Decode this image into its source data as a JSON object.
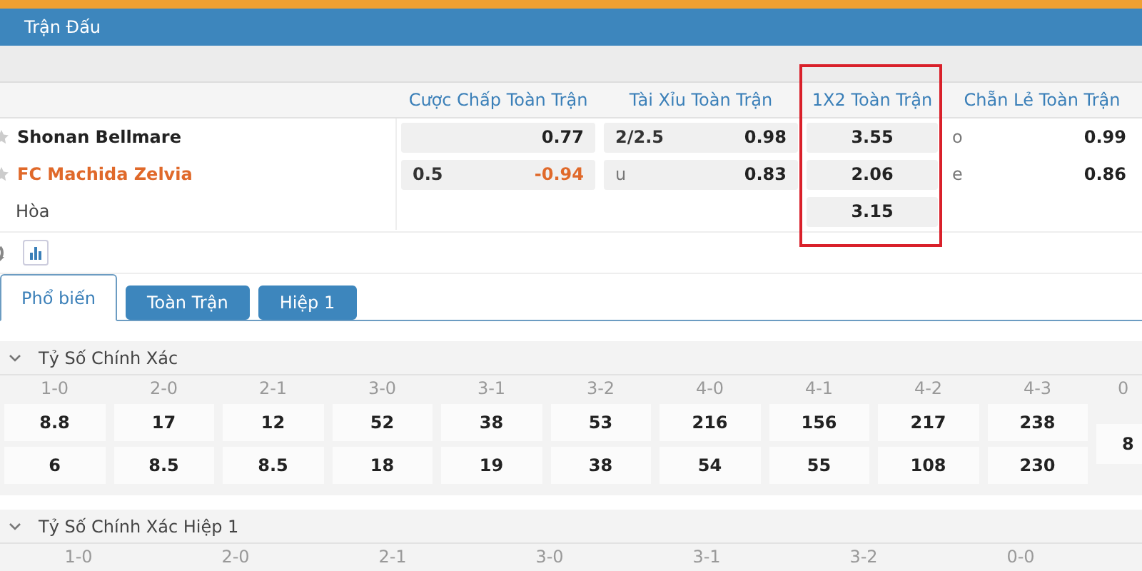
{
  "title": "Trận Đấu",
  "columns": [
    "Cược Chấp Toàn Trận",
    "Tài Xỉu Toàn Trận",
    "1X2 Toàn Trận",
    "Chẵn Lẻ Toàn Trận"
  ],
  "rows": [
    {
      "name": "Shonan Bellmare",
      "kind": "team",
      "highlighted": false,
      "handicap": {
        "odds": "0.77",
        "negative": false
      },
      "total": {
        "line": "2/2.5",
        "odds": "0.98"
      },
      "x12": "3.55",
      "oddeven": {
        "line": "o",
        "odds": "0.99"
      }
    },
    {
      "name": "FC Machida Zelvia",
      "kind": "team",
      "highlighted": true,
      "handicap": {
        "line": "0.5",
        "odds": "-0.94",
        "negative": true
      },
      "total": {
        "line": "u",
        "odds": "0.83"
      },
      "x12": "2.06",
      "oddeven": {
        "line": "e",
        "odds": "0.86"
      }
    },
    {
      "name": "Hòa",
      "kind": "draw",
      "x12": "3.15"
    }
  ],
  "tabs": [
    {
      "label": "Phổ biến",
      "selected": true
    },
    {
      "label": "Toàn Trận",
      "selected": false
    },
    {
      "label": "Hiệp 1",
      "selected": false
    }
  ],
  "sections": [
    {
      "title": "Tỷ Số Chính Xác",
      "expanded": true,
      "scores": [
        {
          "label": "1-0",
          "values": [
            "8.8",
            "6"
          ]
        },
        {
          "label": "2-0",
          "values": [
            "17",
            "8.5"
          ]
        },
        {
          "label": "2-1",
          "values": [
            "12",
            "8.5"
          ]
        },
        {
          "label": "3-0",
          "values": [
            "52",
            "18"
          ]
        },
        {
          "label": "3-1",
          "values": [
            "38",
            "19"
          ]
        },
        {
          "label": "3-2",
          "values": [
            "53",
            "38"
          ]
        },
        {
          "label": "4-0",
          "values": [
            "216",
            "54"
          ]
        },
        {
          "label": "4-1",
          "values": [
            "156",
            "55"
          ]
        },
        {
          "label": "4-2",
          "values": [
            "217",
            "108"
          ]
        },
        {
          "label": "4-3",
          "values": [
            "238",
            "230"
          ]
        },
        {
          "label": "0",
          "values": [
            "8"
          ]
        }
      ]
    },
    {
      "title": "Tỷ Số Chính Xác Hiệp 1",
      "expanded": true,
      "scores": [
        {
          "label": "1-0"
        },
        {
          "label": "2-0"
        },
        {
          "label": "2-1"
        },
        {
          "label": "3-0"
        },
        {
          "label": "3-1"
        },
        {
          "label": "3-2"
        },
        {
          "label": "0-0"
        }
      ]
    }
  ]
}
